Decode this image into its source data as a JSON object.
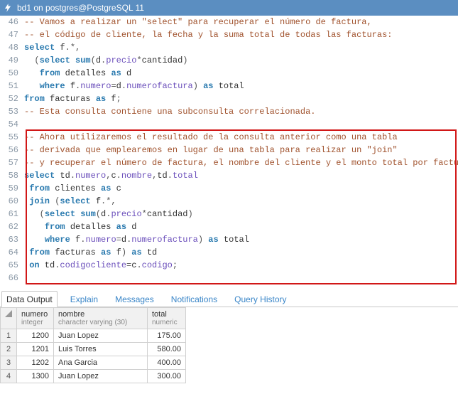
{
  "titlebar": {
    "text": "bd1 on postgres@PostgreSQL 11"
  },
  "code": {
    "lines": [
      {
        "n": 46,
        "html": "<span class='c-comment'>-- Vamos a realizar un \"select\" para recuperar el número de factura,</span>"
      },
      {
        "n": 47,
        "html": "<span class='c-comment'>-- el código de cliente, la fecha y la suma total de todas las facturas:</span>"
      },
      {
        "n": 48,
        "html": "<span class='c-kw'>select</span> f<span class='c-op'>.*,</span>"
      },
      {
        "n": 49,
        "html": "  <span class='c-op'>(</span><span class='c-kw'>select</span> <span class='c-kw'>sum</span><span class='c-op'>(</span>d<span class='c-op'>.</span><span class='c-field'>precio</span><span class='c-op'>*</span>cantidad<span class='c-op'>)</span>"
      },
      {
        "n": 50,
        "html": "   <span class='c-kw'>from</span> detalles <span class='c-kw'>as</span> d"
      },
      {
        "n": 51,
        "html": "   <span class='c-kw'>where</span> f<span class='c-op'>.</span><span class='c-field'>numero</span><span class='c-op'>=</span>d<span class='c-op'>.</span><span class='c-field'>numerofactura</span><span class='c-op'>)</span> <span class='c-kw'>as</span> total"
      },
      {
        "n": 52,
        "html": "<span class='c-kw'>from</span> facturas <span class='c-kw'>as</span> f<span class='c-op'>;</span>"
      },
      {
        "n": 53,
        "html": "<span class='c-comment'>-- Esta consulta contiene una subconsulta correlacionada.</span>"
      },
      {
        "n": 54,
        "html": ""
      },
      {
        "n": 55,
        "html": "<span class='c-comment'>-- Ahora utilizaremos el resultado de la consulta anterior como una tabla</span>"
      },
      {
        "n": 56,
        "html": "<span class='c-comment'>-- derivada que emplearemos en lugar de una tabla para realizar un \"join\"</span>"
      },
      {
        "n": 57,
        "html": "<span class='c-comment'>-- y recuperar el número de factura, el nombre del cliente y el monto total por factura:</span>"
      },
      {
        "n": 58,
        "html": "<span class='c-kw'>select</span> td<span class='c-op'>.</span><span class='c-field'>numero</span><span class='c-op'>,</span>c<span class='c-op'>.</span><span class='c-field'>nombre</span><span class='c-op'>,</span>td<span class='c-op'>.</span><span class='c-field'>total</span>"
      },
      {
        "n": 59,
        "html": " <span class='c-kw'>from</span> clientes <span class='c-kw'>as</span> c"
      },
      {
        "n": 60,
        "html": " <span class='c-kw'>join</span> <span class='c-op'>(</span><span class='c-kw'>select</span> f<span class='c-op'>.*,</span>"
      },
      {
        "n": 61,
        "html": "   <span class='c-op'>(</span><span class='c-kw'>select</span> <span class='c-kw'>sum</span><span class='c-op'>(</span>d<span class='c-op'>.</span><span class='c-field'>precio</span><span class='c-op'>*</span>cantidad<span class='c-op'>)</span>"
      },
      {
        "n": 62,
        "html": "    <span class='c-kw'>from</span> detalles <span class='c-kw'>as</span> d"
      },
      {
        "n": 63,
        "html": "    <span class='c-kw'>where</span> f<span class='c-op'>.</span><span class='c-field'>numero</span><span class='c-op'>=</span>d<span class='c-op'>.</span><span class='c-field'>numerofactura</span><span class='c-op'>)</span> <span class='c-kw'>as</span> total"
      },
      {
        "n": 64,
        "html": " <span class='c-kw'>from</span> facturas <span class='c-kw'>as</span> f<span class='c-op'>)</span> <span class='c-kw'>as</span> td"
      },
      {
        "n": 65,
        "html": " <span class='c-kw'>on</span> td<span class='c-op'>.</span><span class='c-field'>codigocliente</span><span class='c-op'>=</span>c<span class='c-op'>.</span><span class='c-field'>codigo</span><span class='c-op'>;</span>"
      },
      {
        "n": 66,
        "html": ""
      }
    ],
    "highlight": {
      "start": 55,
      "end": 66
    }
  },
  "tabs": {
    "items": [
      {
        "label": "Data Output",
        "active": true
      },
      {
        "label": "Explain",
        "active": false
      },
      {
        "label": "Messages",
        "active": false
      },
      {
        "label": "Notifications",
        "active": false
      },
      {
        "label": "Query History",
        "active": false
      }
    ]
  },
  "grid": {
    "columns": [
      {
        "name": "numero",
        "type": "integer",
        "cls": "col-numero",
        "numeric": true
      },
      {
        "name": "nombre",
        "type": "character varying (30)",
        "cls": "col-nombre",
        "numeric": false
      },
      {
        "name": "total",
        "type": "numeric",
        "cls": "col-total",
        "numeric": true
      }
    ],
    "rows": [
      {
        "numero": "1200",
        "nombre": "Juan Lopez",
        "total": "175.00"
      },
      {
        "numero": "1201",
        "nombre": "Luis Torres",
        "total": "580.00"
      },
      {
        "numero": "1202",
        "nombre": "Ana Garcia",
        "total": "400.00"
      },
      {
        "numero": "1300",
        "nombre": "Juan Lopez",
        "total": "300.00"
      }
    ]
  }
}
